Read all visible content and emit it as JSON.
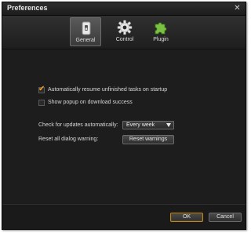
{
  "window": {
    "title": "Preferences",
    "close_symbol": "✕"
  },
  "tabs": [
    {
      "label": "General",
      "icon": "general-switch-icon",
      "active": true
    },
    {
      "label": "Control",
      "icon": "gear-icon",
      "active": false
    },
    {
      "label": "Plugin",
      "icon": "puzzle-piece-icon",
      "active": false
    }
  ],
  "general": {
    "auto_resume": {
      "label": "Automatically resume unfinished tasks on startup",
      "checked": true
    },
    "show_popup": {
      "label": "Show popup on download success",
      "checked": false
    },
    "check_updates": {
      "label": "Check for updates automatically:",
      "value": "Every week"
    },
    "reset_dialog": {
      "label": "Reset all dialog warning:",
      "button_label": "Reset warnings"
    }
  },
  "footer": {
    "ok_label": "OK",
    "cancel_label": "Cancel"
  },
  "colors": {
    "accent": "#f0a020",
    "plugin_green": "#7ac143",
    "background": "#1d1d1d"
  }
}
